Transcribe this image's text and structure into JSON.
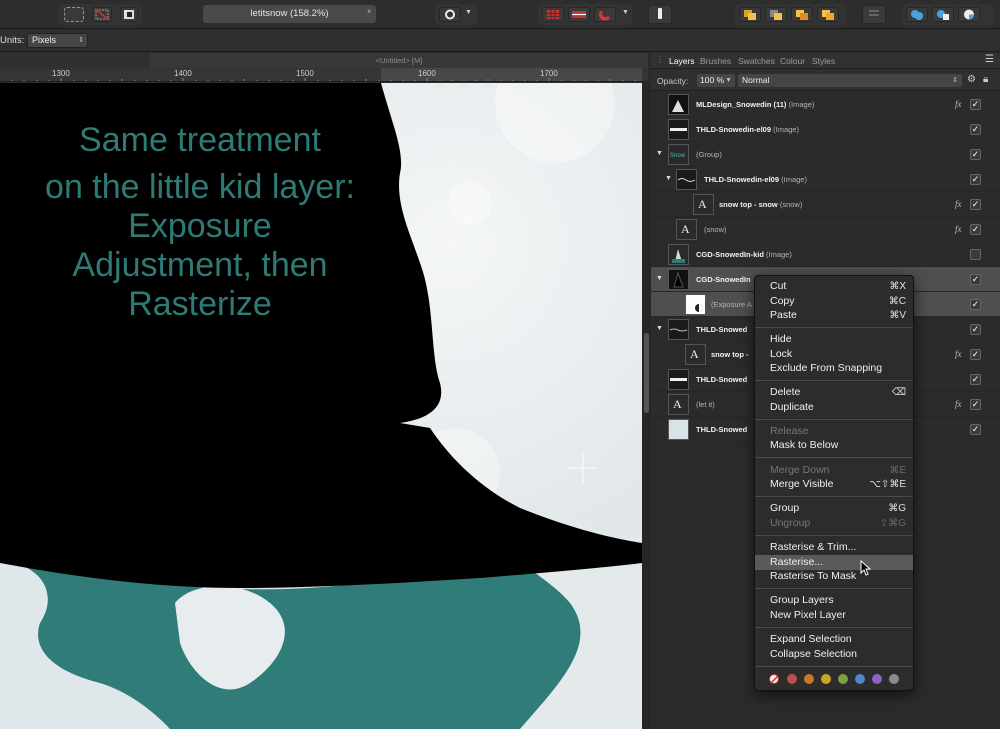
{
  "toolbar": {
    "document_title": "letitsnow (158.2%)",
    "document_modified_marker": "*"
  },
  "context_toolbar": {
    "units_label": "Units:",
    "units_value": "Pixels"
  },
  "document_tab": {
    "label": "<Untitled> [M]"
  },
  "ruler": {
    "ticks": [
      "1300",
      "1400",
      "1500",
      "1600",
      "1700"
    ]
  },
  "canvas": {
    "caption_line1": "Same treatment",
    "caption_line2": "on the little kid layer: Exposure Adjustment, then Rasterize",
    "teal_color": "#2e7b76"
  },
  "panel": {
    "tabs": [
      "Layers",
      "Brushes",
      "Swatches",
      "Colour",
      "Styles"
    ],
    "active_tab": "Layers",
    "opacity_label": "Opacity:",
    "opacity_value": "100 %",
    "blend_mode": "Normal",
    "layers": [
      {
        "name": "MLDesign_Snowedin (11)",
        "type": "(Image)",
        "fx": true,
        "checked": true,
        "indent": 0
      },
      {
        "name": "THLD-Snowedin-el09",
        "type": "(Image)",
        "fx": false,
        "checked": true,
        "indent": 0
      },
      {
        "name": "",
        "type": "(Group)",
        "fx": false,
        "checked": true,
        "indent": 0,
        "expanded": true
      },
      {
        "name": "THLD-Snowedin-el09",
        "type": "(Image)",
        "fx": false,
        "checked": true,
        "indent": 1,
        "expanded": true
      },
      {
        "name": "snow top - snow",
        "type": "(snow)",
        "fx": true,
        "checked": true,
        "indent": 2
      },
      {
        "name": "",
        "type": "(snow)",
        "fx": true,
        "checked": true,
        "indent": 1
      },
      {
        "name": "CGD-SnowedIn-kid",
        "type": "(Image)",
        "fx": false,
        "checked": false,
        "indent": 0
      },
      {
        "name": "CGD-SnowedIn",
        "type": "",
        "fx": false,
        "checked": true,
        "indent": 0,
        "expanded": true,
        "selected": true
      },
      {
        "name": "",
        "type": "(Exposure A",
        "fx": false,
        "checked": true,
        "indent": 1,
        "selected": true
      },
      {
        "name": "THLD-Snowed",
        "type": "",
        "fx": false,
        "checked": true,
        "indent": 0,
        "expanded": true
      },
      {
        "name": "snow top -",
        "type": "",
        "fx": true,
        "checked": true,
        "indent": 1
      },
      {
        "name": "THLD-Snowed",
        "type": "",
        "fx": false,
        "checked": true,
        "indent": 0
      },
      {
        "name": "",
        "type": "(let it)",
        "fx": true,
        "checked": true,
        "indent": 0
      },
      {
        "name": "THLD-Snowed",
        "type": "",
        "fx": false,
        "checked": true,
        "indent": 0
      }
    ]
  },
  "context_menu": {
    "items": [
      {
        "label": "Cut",
        "shortcut": "⌘X",
        "disabled": false
      },
      {
        "label": "Copy",
        "shortcut": "⌘C",
        "disabled": false
      },
      {
        "label": "Paste",
        "shortcut": "⌘V",
        "disabled": false
      },
      {
        "label": "Hide",
        "shortcut": "",
        "disabled": false
      },
      {
        "label": "Lock",
        "shortcut": "",
        "disabled": false
      },
      {
        "label": "Exclude From Snapping",
        "shortcut": "",
        "disabled": false
      },
      {
        "label": "Delete",
        "shortcut": "⌫",
        "disabled": false
      },
      {
        "label": "Duplicate",
        "shortcut": "",
        "disabled": false
      },
      {
        "label": "Release",
        "shortcut": "",
        "disabled": true
      },
      {
        "label": "Mask to Below",
        "shortcut": "",
        "disabled": false
      },
      {
        "label": "Merge Down",
        "shortcut": "⌘E",
        "disabled": true
      },
      {
        "label": "Merge Visible",
        "shortcut": "⌥⇧⌘E",
        "disabled": false
      },
      {
        "label": "Group",
        "shortcut": "⌘G",
        "disabled": false
      },
      {
        "label": "Ungroup",
        "shortcut": "⇧⌘G",
        "disabled": true
      },
      {
        "label": "Rasterise & Trim...",
        "shortcut": "",
        "disabled": false
      },
      {
        "label": "Rasterise...",
        "shortcut": "",
        "disabled": false,
        "highlighted": true
      },
      {
        "label": "Rasterise To Mask",
        "shortcut": "",
        "disabled": false
      },
      {
        "label": "Group Layers",
        "shortcut": "",
        "disabled": false
      },
      {
        "label": "New Pixel Layer",
        "shortcut": "",
        "disabled": false
      },
      {
        "label": "Expand Selection",
        "shortcut": "",
        "disabled": false
      },
      {
        "label": "Collapse Selection",
        "shortcut": "",
        "disabled": false
      }
    ],
    "tag_colors": [
      "none",
      "#c24b4b",
      "#c9782a",
      "#c9a62a",
      "#7aa23f",
      "#4e88c7",
      "#8f62c4",
      "#8a8a8a"
    ]
  }
}
